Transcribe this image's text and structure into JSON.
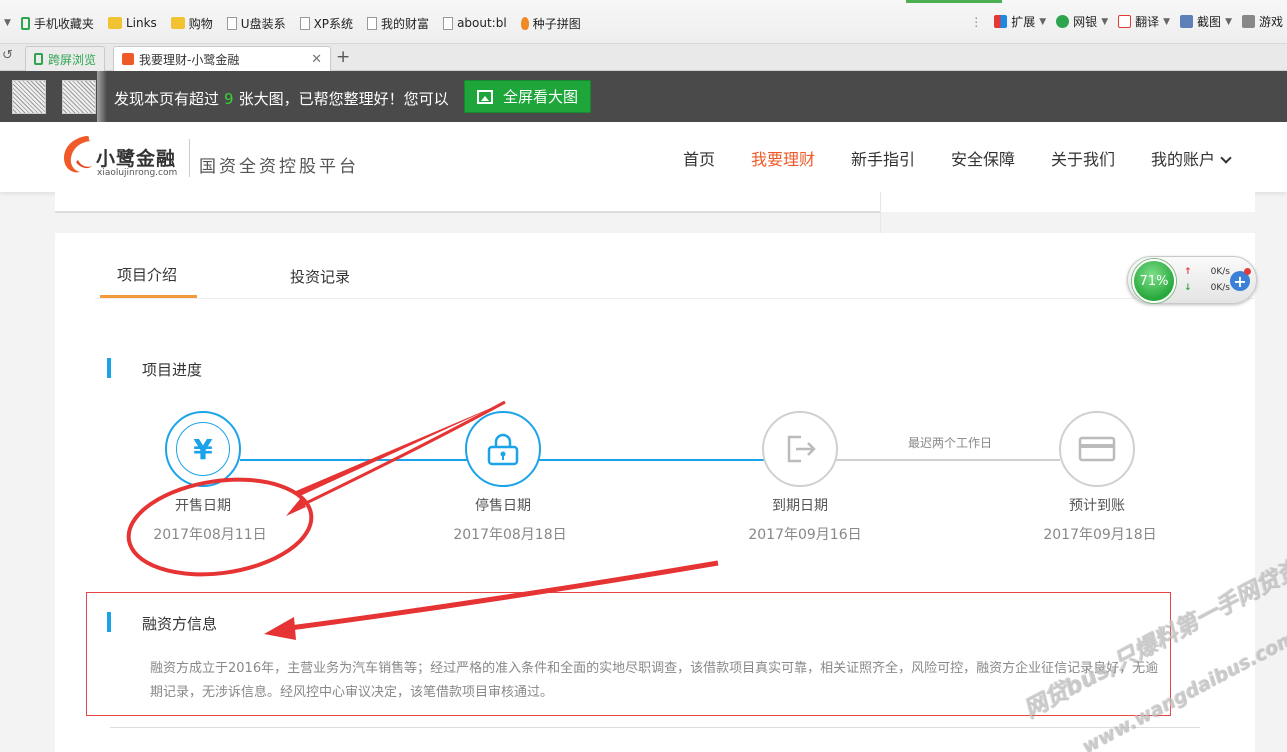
{
  "bookmarks": {
    "items": [
      {
        "label": "手机收藏夹"
      },
      {
        "label": "Links"
      },
      {
        "label": "购物"
      },
      {
        "label": "U盘装系"
      },
      {
        "label": "XP系统"
      },
      {
        "label": "我的财富"
      },
      {
        "label": "about:bl"
      },
      {
        "label": "种子拼图"
      }
    ],
    "right": {
      "extend": "扩展",
      "bank": "网银",
      "translate": "翻译",
      "screenshot": "截图",
      "games": "游戏"
    }
  },
  "tabs": [
    {
      "label": "跨屏浏览"
    },
    {
      "label": "我要理财-小鹭金融",
      "active": true
    }
  ],
  "notice": {
    "text_prefix": "发现本页有超过",
    "count": "9",
    "text_suffix": "张大图，已帮您整理好！您可以",
    "button_label": "全屏看大图"
  },
  "site": {
    "logo_name": "小鹭金融",
    "logo_url": "xiaolujinrong.com",
    "slogan": "国资全资控股平台",
    "nav": [
      {
        "label": "首页"
      },
      {
        "label": "我要理财",
        "active": true
      },
      {
        "label": "新手指引"
      },
      {
        "label": "安全保障"
      },
      {
        "label": "关于我们"
      },
      {
        "label": "我的账户"
      }
    ]
  },
  "project_tabs": [
    {
      "label": "项目介绍",
      "active": true
    },
    {
      "label": "投资记录"
    }
  ],
  "progress": {
    "title": "项目进度",
    "arrival_note": "最迟两个工作日",
    "steps": [
      {
        "label": "开售日期",
        "date": "2017年08月11日",
        "icon": "yuan-icon",
        "done": true
      },
      {
        "label": "停售日期",
        "date": "2017年08月18日",
        "icon": "lock-icon",
        "done": true
      },
      {
        "label": "到期日期",
        "date": "2017年09月16日",
        "icon": "exit-icon",
        "done": false
      },
      {
        "label": "预计到账",
        "date": "2017年09月18日",
        "icon": "card-icon",
        "done": false
      }
    ],
    "colors": {
      "active": "#1aa3e8",
      "inactive": "#d0d0d0"
    }
  },
  "financier": {
    "title": "融资方信息",
    "description": "融资方成立于2016年，主营业务为汽车销售等；经过严格的准入条件和全面的实地尽职调查，该借款项目真实可靠，相关证照齐全，风险可控，融资方企业征信记录良好，无逾期记录，无涉诉信息。经风控中心审议决定，该笔借款项目审核通过。"
  },
  "speed_widget": {
    "percent": "71%",
    "up": "0K/s",
    "down": "0K/s"
  },
  "watermark": {
    "line1": "网贷bus,只爆料第一手网贷资讯",
    "line2": "www.wangdaibus.com"
  },
  "colors": {
    "brand": "#f05a28",
    "accent": "#1aa3e8",
    "annotation": "#e63333"
  }
}
